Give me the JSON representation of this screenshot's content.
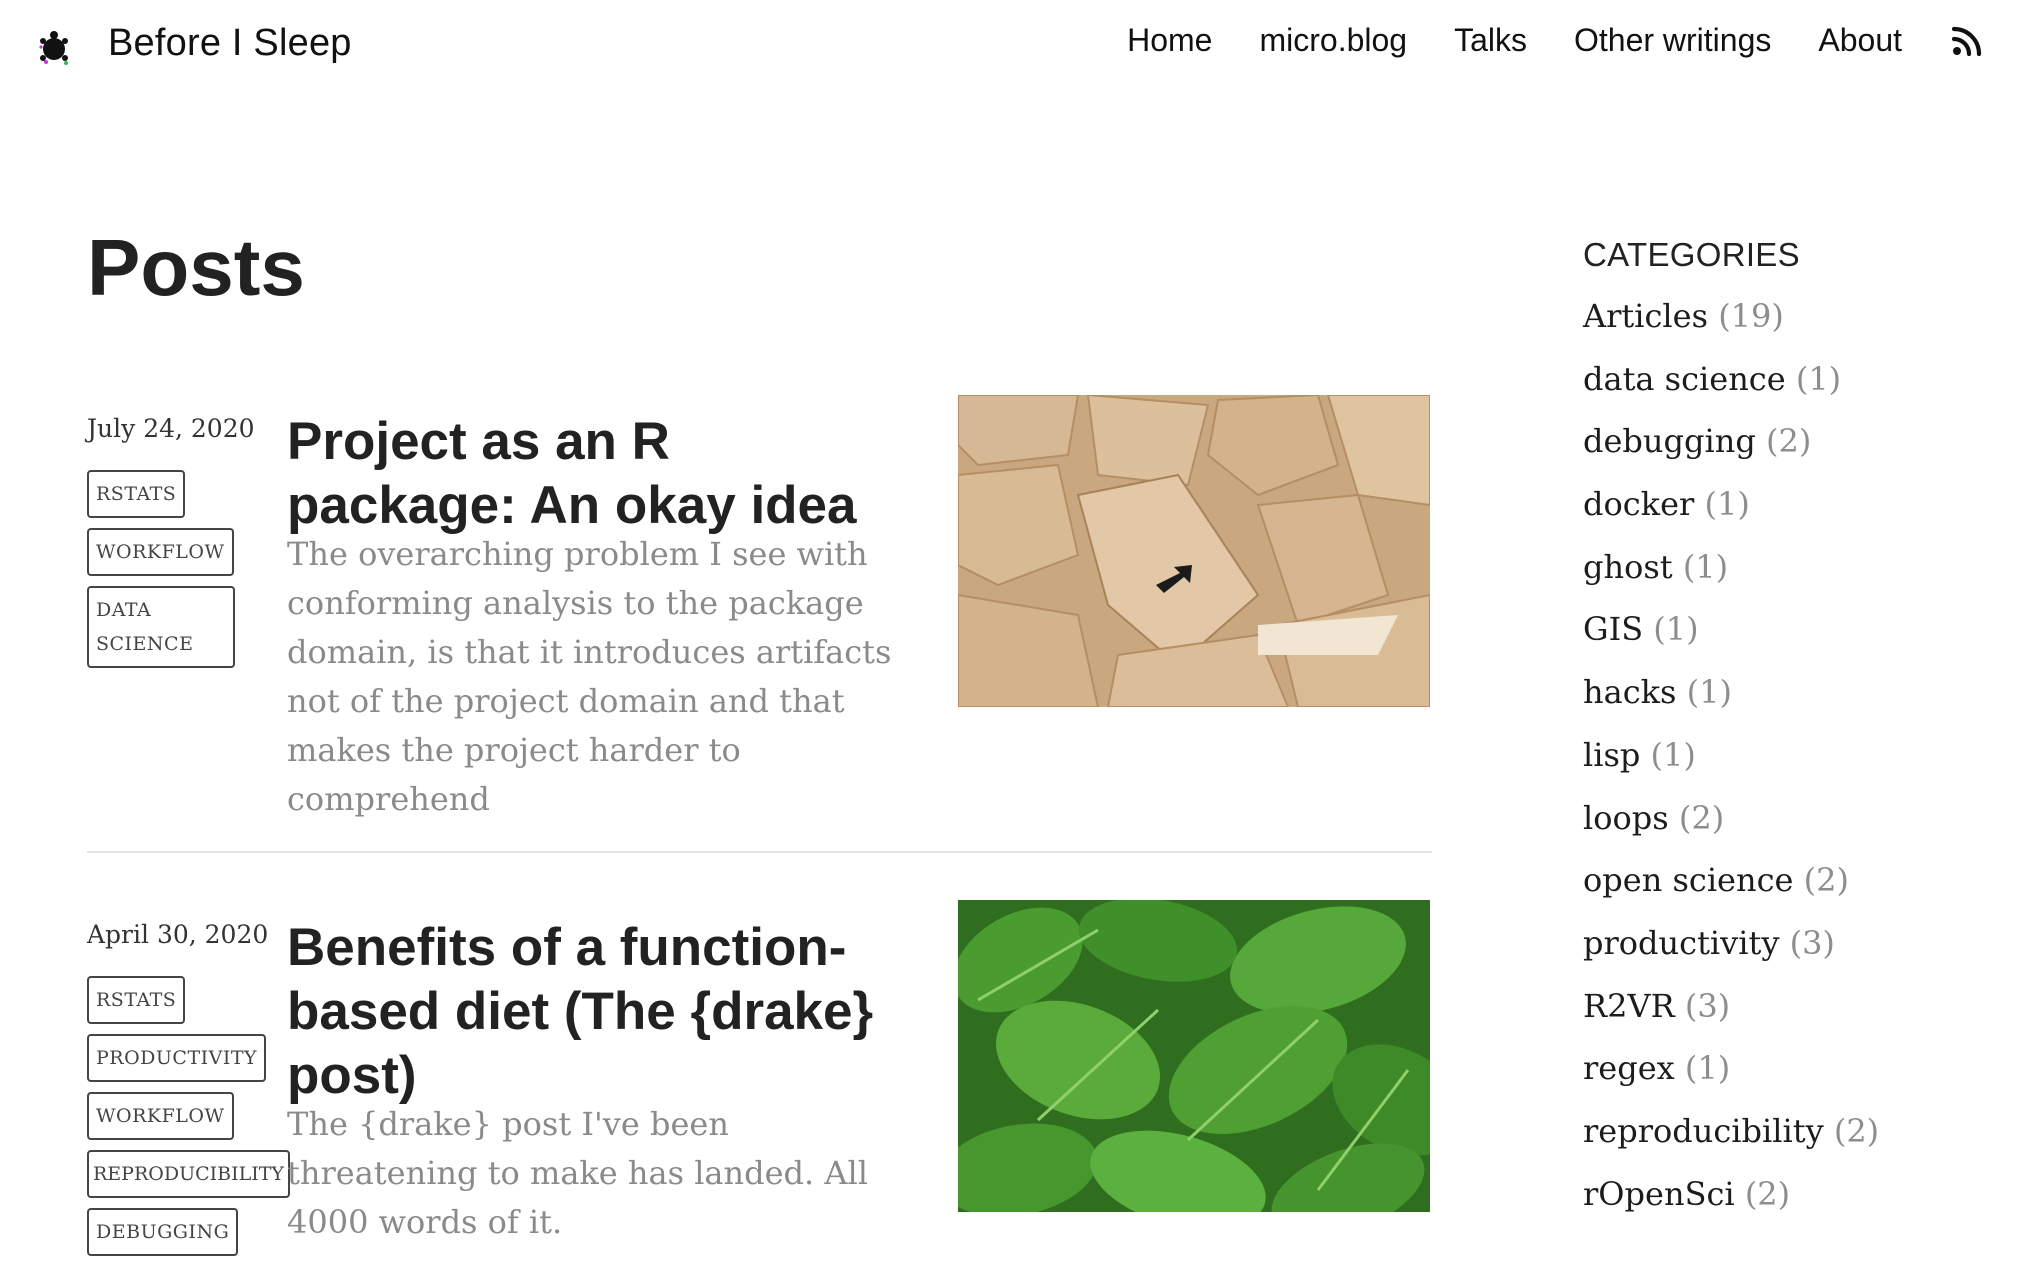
{
  "site": {
    "title": "Before I Sleep",
    "logo_icon": "turtle-logo-icon"
  },
  "nav": {
    "items": [
      {
        "label": "Home"
      },
      {
        "label": "micro.blog"
      },
      {
        "label": "Talks"
      },
      {
        "label": "Other writings"
      },
      {
        "label": "About"
      }
    ],
    "rss_icon": "rss-icon"
  },
  "main": {
    "heading": "Posts",
    "posts": [
      {
        "date": "July 24, 2020",
        "tags": [
          "RSTATS",
          "WORKFLOW",
          "DATA SCIENCE"
        ],
        "title": "Project as an R package: An okay idea",
        "excerpt": "The overarching problem I see with conforming analysis to the package domain, is that it introduces artifacts not of the project domain and that makes the project harder to comprehend",
        "image_icon": "cardboard-image"
      },
      {
        "date": "April 30, 2020",
        "tags": [
          "RSTATS",
          "PRODUCTIVITY",
          "WORKFLOW",
          "REPRODUCIBILITY",
          "DEBUGGING"
        ],
        "title": "Benefits of a function-based diet (The {drake} post)",
        "excerpt": "The {drake} post I've been threatening to make has landed. All 4000 words of it.",
        "image_icon": "spinach-image"
      }
    ]
  },
  "sidebar": {
    "heading": "CATEGORIES",
    "categories": [
      {
        "name": "Articles",
        "count": "(19)"
      },
      {
        "name": "data science",
        "count": "(1)"
      },
      {
        "name": "debugging",
        "count": "(2)"
      },
      {
        "name": "docker",
        "count": "(1)"
      },
      {
        "name": "ghost",
        "count": "(1)"
      },
      {
        "name": "GIS",
        "count": "(1)"
      },
      {
        "name": "hacks",
        "count": "(1)"
      },
      {
        "name": "lisp",
        "count": "(1)"
      },
      {
        "name": "loops",
        "count": "(2)"
      },
      {
        "name": "open science",
        "count": "(2)"
      },
      {
        "name": "productivity",
        "count": "(3)"
      },
      {
        "name": "R2VR",
        "count": "(3)"
      },
      {
        "name": "regex",
        "count": "(1)"
      },
      {
        "name": "reproducibility",
        "count": "(2)"
      },
      {
        "name": "rOpenSci",
        "count": "(2)"
      }
    ]
  },
  "colors": {
    "text": "#1c1c1c",
    "muted": "#8a8a8a",
    "divider": "#e3e3e3",
    "cardboard": "#d2b48c",
    "spinach": "#3f8f2a"
  }
}
